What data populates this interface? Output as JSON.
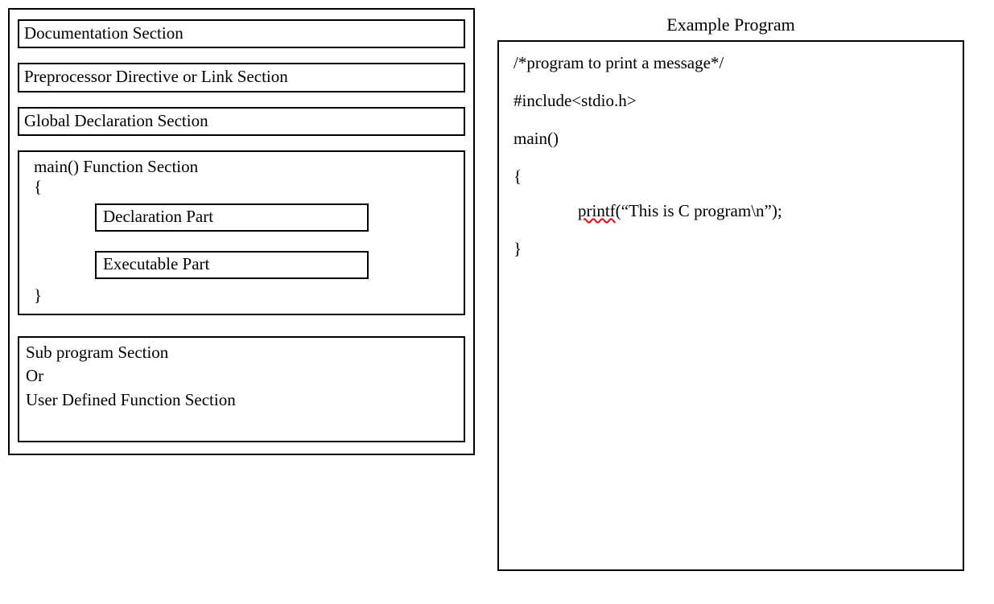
{
  "left": {
    "doc": "Documentation Section",
    "preproc": "Preprocessor Directive or Link Section",
    "global": "Global Declaration Section",
    "main_title": "main()  Function Section",
    "brace_open": "{",
    "decl_part": "Declaration Part",
    "exec_part": "Executable Part",
    "brace_close": "}",
    "sub_line1": "Sub program Section",
    "sub_line2": "Or",
    "sub_line3": "User Defined Function Section"
  },
  "right": {
    "title": "Example Program",
    "line1": "/*program to print a message*/",
    "line2": "#include<stdio.h>",
    "line3": "main()",
    "line4": "{",
    "printf_word": "printf",
    "printf_rest": "(“This is C program\\n”);",
    "line6": "}"
  }
}
